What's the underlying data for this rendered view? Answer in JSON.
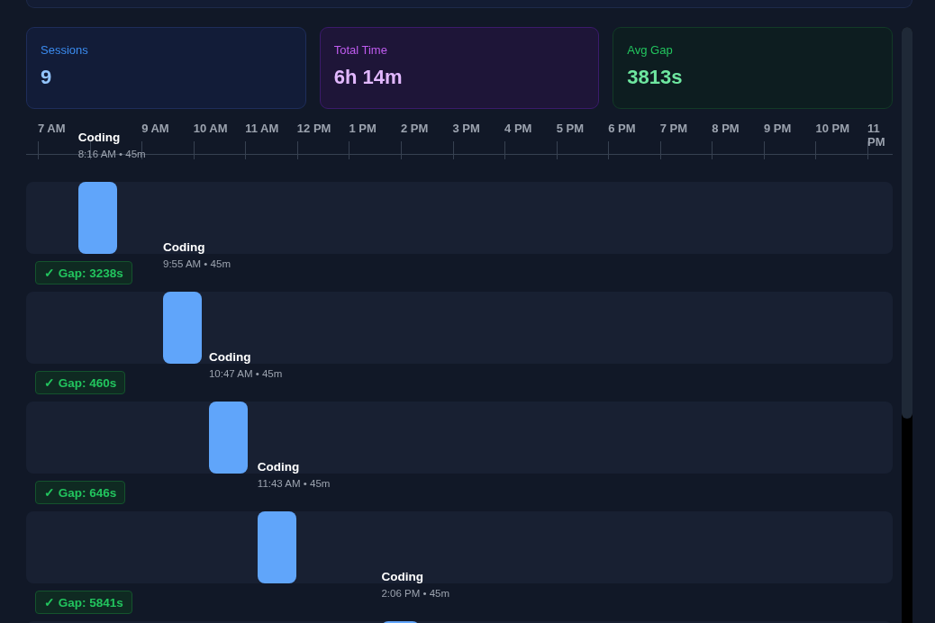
{
  "stats": [
    {
      "label": "Sessions",
      "value": "9",
      "kind": "blue"
    },
    {
      "label": "Total Time",
      "value": "6h 14m",
      "kind": "purple"
    },
    {
      "label": "Avg Gap",
      "value": "3813s",
      "kind": "green"
    }
  ],
  "axis": {
    "hours": [
      {
        "label": "7 AM",
        "kind": "label"
      },
      {
        "kind": "tick"
      },
      {
        "label": "9 AM"
      },
      {
        "label": "10 AM"
      },
      {
        "label": "11 AM"
      },
      {
        "label": "12 PM"
      },
      {
        "label": "1 PM"
      },
      {
        "label": "2 PM"
      },
      {
        "label": "3 PM"
      },
      {
        "label": "4 PM"
      },
      {
        "label": "5 PM"
      },
      {
        "label": "6 PM"
      },
      {
        "label": "7 PM"
      },
      {
        "label": "8 PM"
      },
      {
        "label": "9 PM"
      },
      {
        "label": "10 PM"
      },
      {
        "label": "11 PM"
      }
    ]
  },
  "sessions": [
    {
      "title": "Coding",
      "meta": "8:16 AM • 45m",
      "level": 0.06,
      "gap": {
        "text": "✓ Gap: 3238s"
      }
    },
    {
      "title": "Coding",
      "meta": "9:55 AM • 45m",
      "level": 0.158,
      "gap": {
        "text": "✓ Gap: 460s"
      }
    },
    {
      "title": "Coding",
      "meta": "10:47 AM • 45m",
      "level": 0.211,
      "gap": {
        "text": "✓ Gap: 646s"
      }
    },
    {
      "title": "Coding",
      "meta": "11:43 AM • 45m",
      "level": 0.267,
      "gap": {
        "text": "✓ Gap: 5841s"
      }
    },
    {
      "title": "Coding",
      "meta": "2:06 PM • 45m",
      "level": 0.41
    }
  ]
}
